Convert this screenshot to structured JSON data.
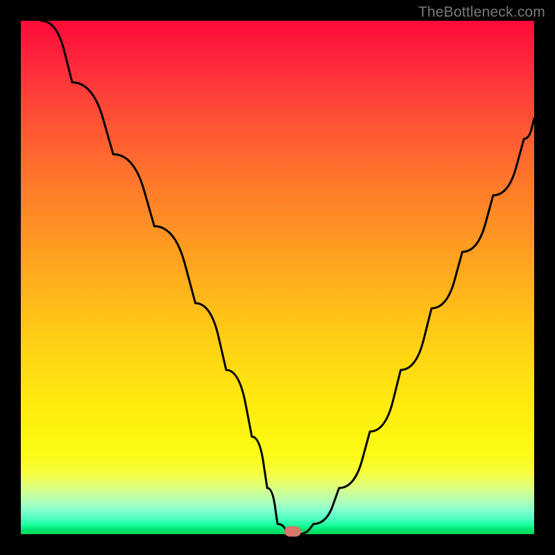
{
  "watermark": {
    "text": "TheBottleneck.com"
  },
  "colors": {
    "curve_stroke": "#000000",
    "marker_fill": "#d9786a",
    "gradient_top": "#ff0a3a",
    "gradient_mid": "#fee70f",
    "gradient_bottom": "#00d858"
  },
  "chart_data": {
    "type": "line",
    "title": "",
    "xlabel": "",
    "ylabel": "",
    "xlim": [
      0,
      100
    ],
    "ylim": [
      0,
      100
    ],
    "grid": false,
    "legend": false,
    "series": [
      {
        "name": "bottleneck-curve",
        "x": [
          4,
          10,
          18,
          26,
          34,
          40,
          45,
          48,
          50,
          52,
          54,
          57,
          62,
          68,
          74,
          80,
          86,
          92,
          98,
          100
        ],
        "y": [
          100,
          88,
          74,
          60,
          45,
          32,
          19,
          9,
          2,
          0,
          0,
          2,
          9,
          20,
          32,
          44,
          55,
          66,
          77,
          81
        ]
      }
    ],
    "annotations": [
      {
        "name": "optimal-point-marker",
        "x": 53,
        "y": 0
      }
    ],
    "background_gradient": {
      "orientation": "vertical",
      "stops": [
        {
          "pos": 0.0,
          "color": "#ff0a3a"
        },
        {
          "pos": 0.5,
          "color": "#ff9922"
        },
        {
          "pos": 0.8,
          "color": "#fdf40f"
        },
        {
          "pos": 1.0,
          "color": "#00d858"
        }
      ]
    }
  }
}
